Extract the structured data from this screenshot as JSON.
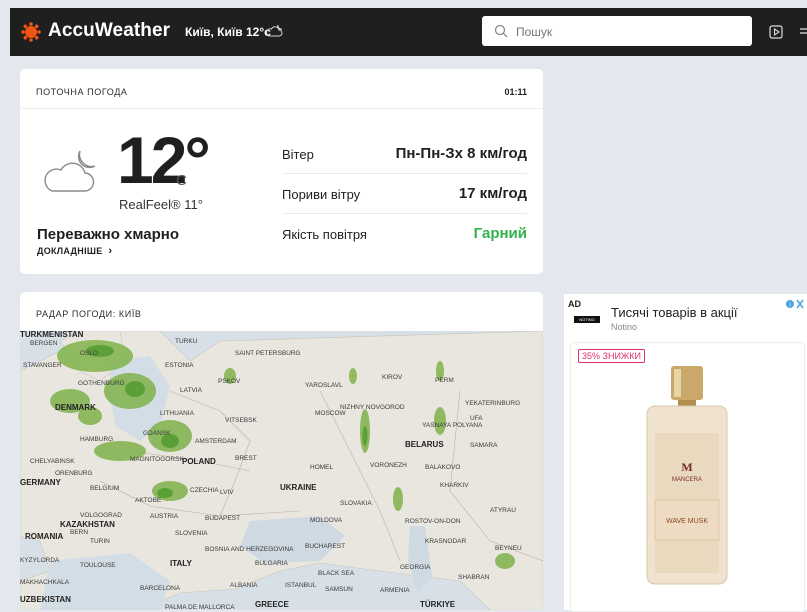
{
  "header": {
    "brand": "AccuWeather",
    "location": "Київ, Київ",
    "temp": "12°c",
    "search_placeholder": "Пошук",
    "colors": {
      "logo": "#f05514",
      "bar": "#1f1f1f"
    }
  },
  "current": {
    "title": "ПОТОЧНА ПОГОДА",
    "time": "01:11",
    "temperature": "12°",
    "unit": "C",
    "realfeel": "RealFeel® 11°",
    "phrase": "Переважно хмарно",
    "more": "ДОКЛАДНІШЕ",
    "icon": "cloud-moon-icon",
    "details": [
      {
        "label": "Вітер",
        "value": "Пн-Пн-Зх 8 км/год"
      },
      {
        "label": "Пориви вітру",
        "value": "17 км/год"
      },
      {
        "label": "Якість повітря",
        "value": "Гарний",
        "color": "#35b14d"
      }
    ]
  },
  "radar": {
    "title": "РАДАР ПОГОДИ: КИЇВ",
    "cities": [
      "BERGEN",
      "OSLO",
      "TURKU",
      "SAINT PETERSBURG",
      "STAVANGER",
      "ESTONIA",
      "GOTHENBURG",
      "LATVIA",
      "PSKOV",
      "YAROSLAVL",
      "KIROV",
      "PERM",
      "DENMARK",
      "LITHUANIA",
      "MOSCOW",
      "VITSEBSK",
      "NIZHNY NOVGOROD",
      "YEKATERINBURG",
      "HAMBURG",
      "GDANSK",
      "YASNAYA POLYANA",
      "UFA",
      "CHELYABINSK",
      "AMSTERDAM",
      "BELARUS",
      "SAMARA",
      "MAGNITOGORSK",
      "POLAND",
      "BREST",
      "HOMEL",
      "VORONEZH",
      "BALAKOVO",
      "ORENBURG",
      "GERMANY",
      "BELGIUM",
      "CZECHIA",
      "LVIV",
      "UKRAINE",
      "KHARKIV",
      "AKTOBE",
      "SLOVAKIA",
      "VOLGOGRAD",
      "AUSTRIA",
      "BUDAPEST",
      "MOLDOVA",
      "ROSTOV-ON-DON",
      "ATYRAU",
      "KAZAKHSTAN",
      "BERN",
      "SLOVENIA",
      "ROMANIA",
      "TURIN",
      "BOSNIA AND HERZEGOVINA",
      "BUCHAREST",
      "KRASNODAR",
      "BEYNEU",
      "KYZYLORDA",
      "TOULOUSE",
      "ITALY",
      "BULGARIA",
      "BLACK SEA",
      "GEORGIA",
      "MAKHACHKALA",
      "BARCELONA",
      "ALBANIA",
      "ISTANBUL",
      "SAMSUN",
      "ARMENIA",
      "SHABRAN",
      "UZBEKISTAN",
      "PALMA DE MALLORCA",
      "GREECE",
      "TÜRKIYE",
      "TURKMENISTAN"
    ]
  },
  "ad": {
    "tag": "AD",
    "title": "Тисячі товарів в акції",
    "advertiser": "Notino",
    "badge": "35% ЗНИЖКИ",
    "logo_text": "NOTINO",
    "product_brand": "MANCERA",
    "product_name": "WAVE MUSK"
  }
}
